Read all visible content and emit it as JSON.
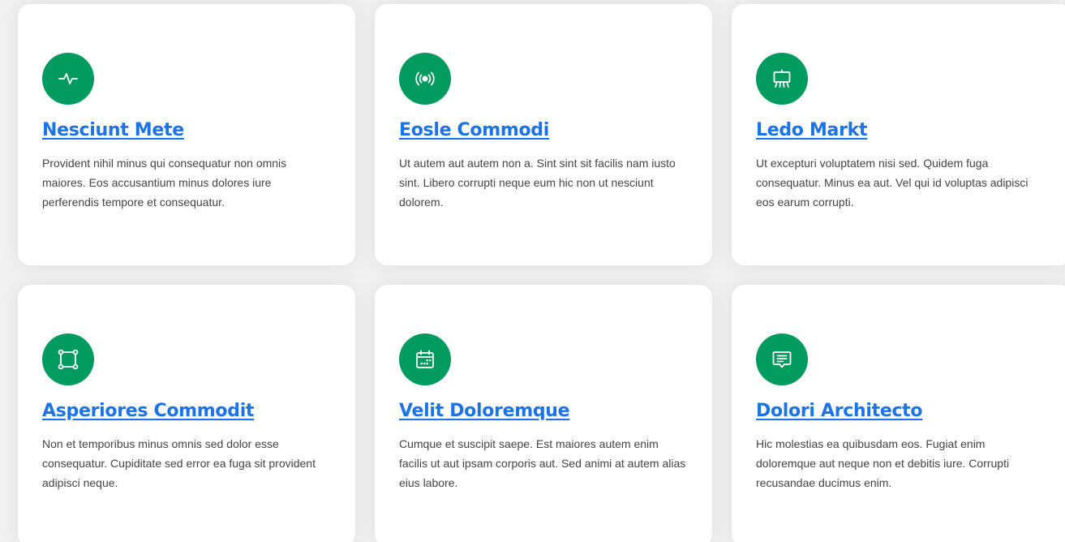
{
  "theme": {
    "icon_background": "#019b5f",
    "title_color": "#1a73e8"
  },
  "cards": [
    {
      "icon": "activity-icon",
      "title": "Nesciunt Mete",
      "description": "Provident nihil minus qui consequatur non omnis maiores. Eos accusantium minus dolores iure perferendis tempore et consequatur."
    },
    {
      "icon": "broadcast-icon",
      "title": "Eosle Commodi",
      "description": "Ut autem aut autem non a. Sint sint sit facilis nam iusto sint. Libero corrupti neque eum hic non ut nesciunt dolorem."
    },
    {
      "icon": "easel-icon",
      "title": "Ledo Markt",
      "description": "Ut excepturi voluptatem nisi sed. Quidem fuga consequatur. Minus ea aut. Vel qui id voluptas adipisci eos earum corrupti."
    },
    {
      "icon": "bounding-box-icon",
      "title": "Asperiores Commodit",
      "description": "Non et temporibus minus omnis sed dolor esse consequatur. Cupiditate sed error ea fuga sit provident adipisci neque."
    },
    {
      "icon": "calendar-icon",
      "title": "Velit Doloremque",
      "description": "Cumque et suscipit saepe. Est maiores autem enim facilis ut aut ipsam corporis aut. Sed animi at autem alias eius labore."
    },
    {
      "icon": "chat-text-icon",
      "title": "Dolori Architecto",
      "description": "Hic molestias ea quibusdam eos. Fugiat enim doloremque aut neque non et debitis iure. Corrupti recusandae ducimus enim."
    }
  ]
}
